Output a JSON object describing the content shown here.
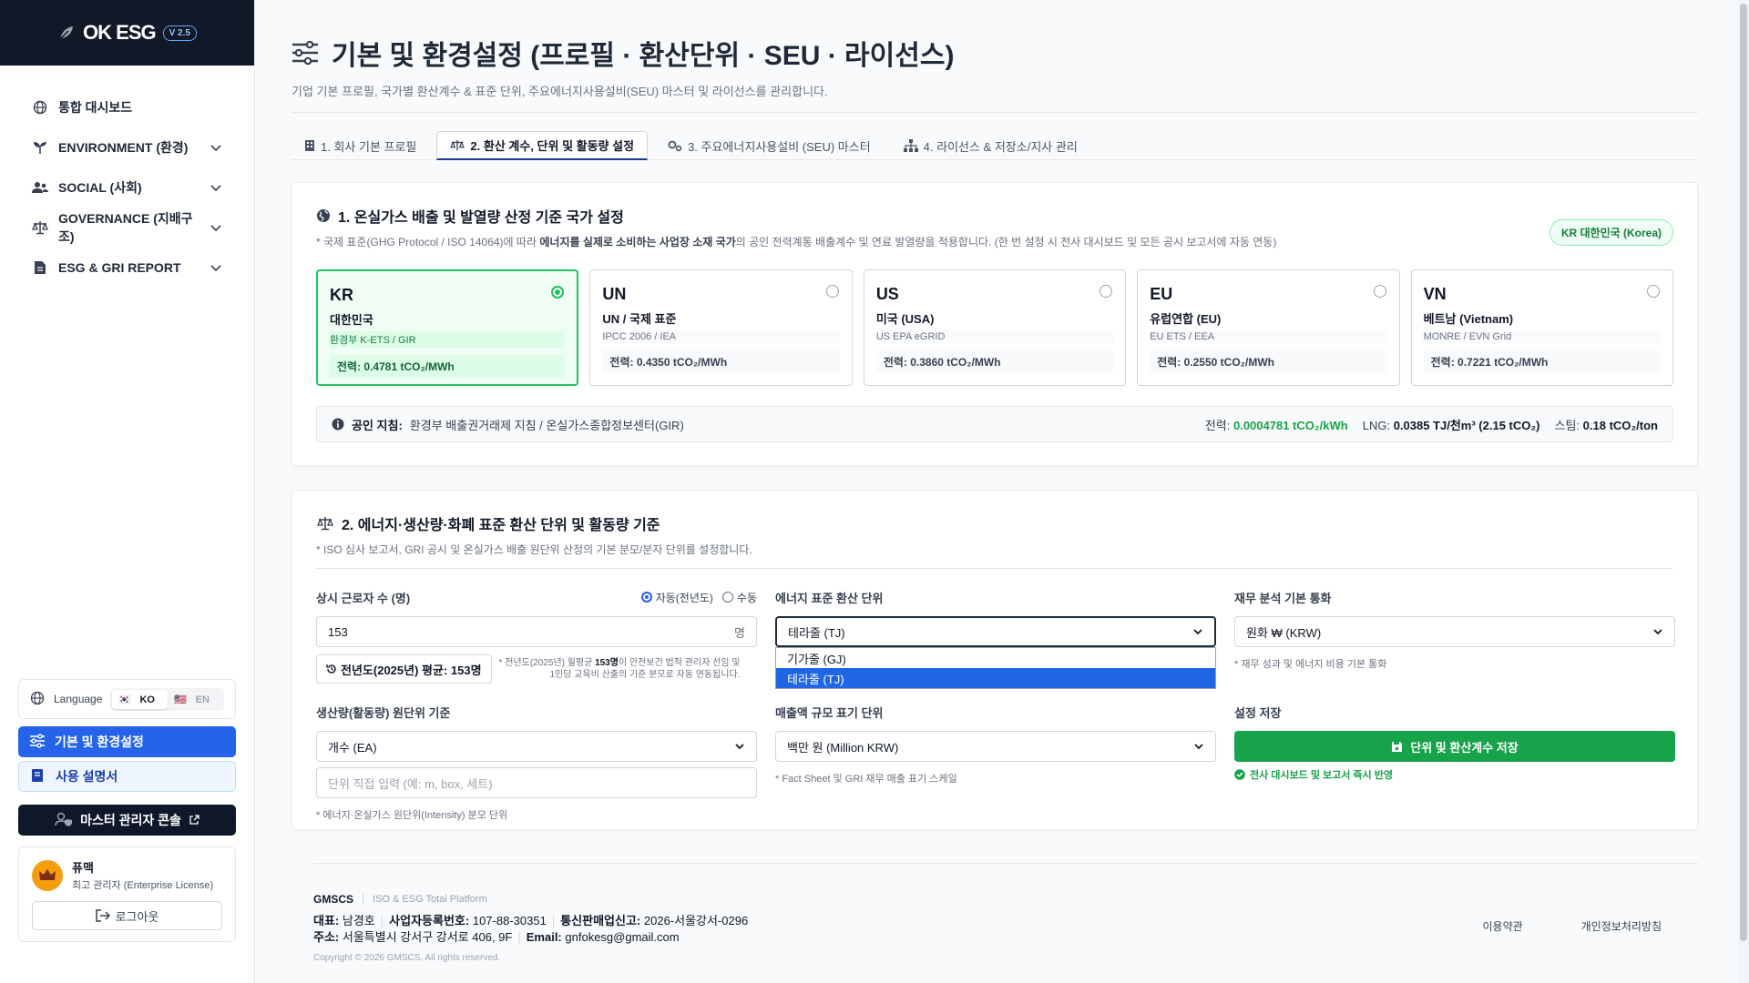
{
  "brand": {
    "name": "OK ESG",
    "version": "V 2.5"
  },
  "sidebar": {
    "items": [
      {
        "label": "통합 대시보드"
      },
      {
        "label": "ENVIRONMENT (환경)"
      },
      {
        "label": "SOCIAL (사회)"
      },
      {
        "label": "GOVERNANCE (지배구조)"
      },
      {
        "label": "ESG & GRI REPORT"
      }
    ],
    "language_label": "Language",
    "lang_ko": "KO",
    "lang_en": "EN",
    "settings_label": "기본 및 환경설정",
    "manual_label": "사용 설명서",
    "master_console_label": "마스터 관리자 콘솔",
    "user_name": "퓨맥",
    "user_role": "최고 관리자 (Enterprise License)",
    "logout_label": "로그아웃"
  },
  "header": {
    "title": "기본 및 환경설정 (프로필 · 환산단위 · SEU · 라이선스)",
    "subtitle": "기업 기본 프로필, 국가별 환산계수 & 표준 단위, 주요에너지사용설비(SEU) 마스터 및 라이선스를 관리합니다."
  },
  "tabs": [
    {
      "label": "1. 회사 기본 프로필"
    },
    {
      "label": "2. 환산 계수, 단위 및 활동량 설정"
    },
    {
      "label": "3. 주요에너지사용설비 (SEU) 마스터"
    },
    {
      "label": "4. 라이선스 & 저장소/지사 관리"
    }
  ],
  "section1": {
    "title": "1. 온실가스 배출 및 발열량 산정 기준 국가 설정",
    "note_prefix": "* 국제 표준(GHG Protocol / ISO 14064)에 따라 ",
    "note_bold": "에너지를 실제로 소비하는 사업장 소재 국가",
    "note_suffix": "의 공인 전력계통 배출계수 및 연료 발열량을 적용합니다. (한 번 설정 시 전사 대시보드 및 모든 공시 보고서에 자동 연동)",
    "selected_badge": "KR 대한민국 (Korea)",
    "countries": [
      {
        "code": "KR",
        "name": "대한민국",
        "source": "환경부 K-ETS / GIR",
        "power": "전력: 0.4781 tCO₂/MWh",
        "selected": true
      },
      {
        "code": "UN",
        "name": "UN / 국제 표준",
        "source": "IPCC 2006 / IEA",
        "power": "전력: 0.4350 tCO₂/MWh",
        "selected": false
      },
      {
        "code": "US",
        "name": "미국 (USA)",
        "source": "US EPA eGRID",
        "power": "전력: 0.3860 tCO₂/MWh",
        "selected": false
      },
      {
        "code": "EU",
        "name": "유럽연합 (EU)",
        "source": "EU ETS / EEA",
        "power": "전력: 0.2550 tCO₂/MWh",
        "selected": false
      },
      {
        "code": "VN",
        "name": "베트남 (Vietnam)",
        "source": "MONRE / EVN Grid",
        "power": "전력: 0.7221 tCO₂/MWh",
        "selected": false
      }
    ],
    "guide_label": "공인 지침:",
    "guide_text": "환경부 배출권거래제 지침 / 온실가스종합정보센터(GIR)",
    "power_label": "전력:",
    "power_value": "0.0004781 tCO₂/kWh",
    "lng_label": "LNG:",
    "lng_value": "0.0385 TJ/천m³ (2.15 tCO₂)",
    "steam_label": "스팀:",
    "steam_value": "0.18 tCO₂/ton"
  },
  "section2": {
    "title": "2. 에너지·생산량·화폐 표준 환산 단위 및 활동량 기준",
    "note": "* ISO 심사 보고서, GRI 공시 및 온실가스 배출 원단위 산정의 기본 분모/분자 단위를 설정합니다.",
    "employees_label": "상시 근로자 수 (명)",
    "mode_auto": "자동(전년도)",
    "mode_manual": "수동",
    "employees_value": "153",
    "employees_unit": "명",
    "avg_button": "전년도(2025년) 평균: 153명",
    "avg_note_1": "* 전년도(2025년) 월평균 ",
    "avg_note_bold": "153명",
    "avg_note_2": "이 안전보건 법적 관리자 선임 및",
    "avg_note_3": "1인당 교육비 산출의 기준 분모로 자동 연동됩니다.",
    "energy_unit_label": "에너지 표준 환산 단위",
    "energy_unit_value": "테라줄 (TJ)",
    "energy_unit_options": [
      "기가줄 (GJ)",
      "테라줄 (TJ)"
    ],
    "currency_label": "재무 분석 기본 통화",
    "currency_value": "원화 ₩ (KRW)",
    "currency_note": "* 재무 성과 및 에너지 비용 기본 통화",
    "production_label": "생산량(활동량) 원단위 기준",
    "production_value": "개수 (EA)",
    "production_placeholder": "단위 직접 입력 (예: m, box, 세트)",
    "production_note": "* 에너지·온실가스 원단위(Intensity) 분모 단위",
    "sales_label": "매출액 규모 표기 단위",
    "sales_value": "백만 원 (Million KRW)",
    "sales_note": "* Fact Sheet 및 GRI 재무 매출 표기 스케일",
    "save_label_heading": "설정 저장",
    "save_button": "단위 및 환산계수 저장",
    "save_note": "전사 대시보드 및 보고서 즉시 반영"
  },
  "footer": {
    "brand": "GMSCS",
    "tagline": "ISO & ESG Total Platform",
    "ceo_label": "대표:",
    "ceo": "남경호",
    "biz_label": "사업자등록번호:",
    "biz": "107-88-30351",
    "mail_order_label": "통신판매업신고:",
    "mail_order": "2026-서울강서-0296",
    "addr_label": "주소:",
    "addr": "서울특별시 강서구 강서로 406, 9F",
    "email_label": "Email:",
    "email": "gnfokesg@gmail.com",
    "copyright": "Copyright © 2026 GMSCS. All rights reserved.",
    "terms": "이용약관",
    "privacy": "개인정보처리방침"
  },
  "colors": {
    "primary": "#2563eb",
    "success": "#16a34a",
    "brand_dark": "#111827"
  }
}
